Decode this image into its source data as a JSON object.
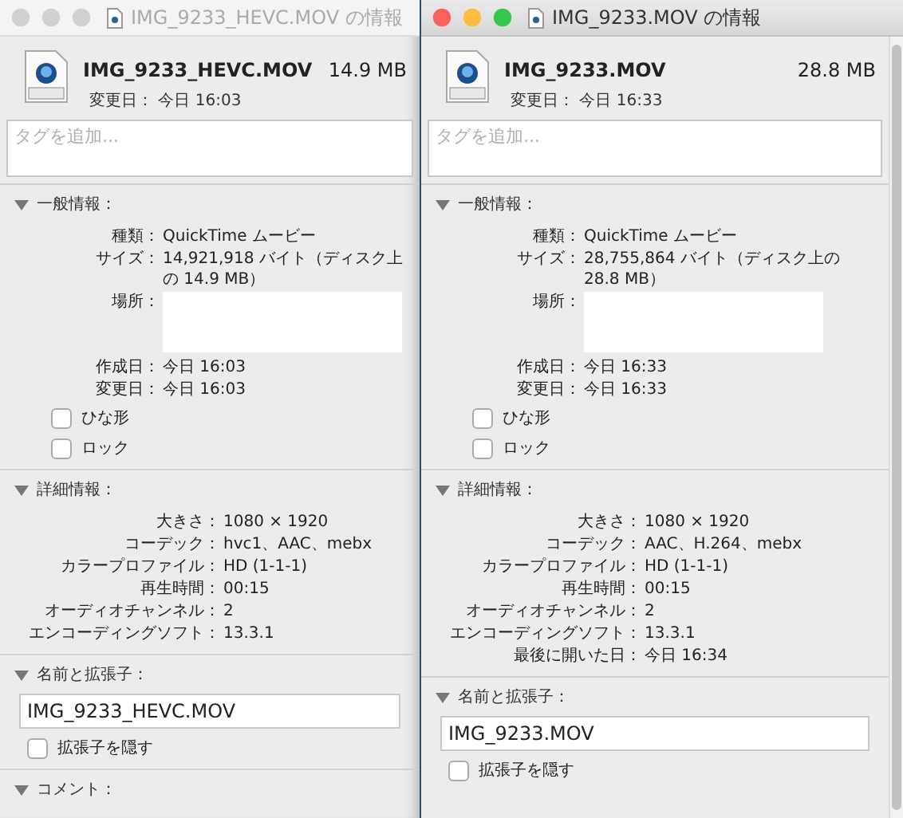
{
  "windows": [
    {
      "active": false,
      "title": "IMG_9233_HEVC.MOV の情報",
      "file_name": "IMG_9233_HEVC.MOV",
      "file_size": "14.9 MB",
      "modified": "変更日： 今日 16:03",
      "tags": {
        "placeholder": "タグを追加..."
      },
      "general": {
        "heading": "一般情報：",
        "expanded": true,
        "rows": [
          {
            "kind": "text",
            "label": "種類：",
            "value": "QuickTime ムービー"
          },
          {
            "kind": "text",
            "label": "サイズ：",
            "value": "14,921,918 バイト（ディスク上の 14.9 MB）"
          },
          {
            "kind": "redacted",
            "label": "場所："
          },
          {
            "kind": "text",
            "label": "作成日：",
            "value": "今日 16:03"
          },
          {
            "kind": "text",
            "label": "変更日：",
            "value": "今日 16:03"
          }
        ],
        "checkboxes": [
          {
            "label": "ひな形",
            "checked": false
          },
          {
            "label": "ロック",
            "checked": false
          }
        ]
      },
      "details": {
        "heading": "詳細情報：",
        "expanded": true,
        "rows": [
          {
            "label": "大きさ：",
            "value": "1080 × 1920"
          },
          {
            "label": "コーデック：",
            "value": "hvc1、AAC、mebx"
          },
          {
            "label": "カラープロファイル：",
            "value": "HD (1-1-1)"
          },
          {
            "label": "再生時間：",
            "value": "00:15"
          },
          {
            "label": "オーディオチャンネル：",
            "value": "2"
          },
          {
            "label": "エンコーディングソフト：",
            "value": "13.3.1"
          }
        ]
      },
      "name_section": {
        "heading": "名前と拡張子：",
        "expanded": true,
        "value": "IMG_9233_HEVC.MOV",
        "hide_extension": {
          "label": "拡張子を隠す",
          "checked": false
        }
      },
      "comment_section": {
        "heading": "コメント：",
        "expanded": true
      }
    },
    {
      "active": true,
      "title": "IMG_9233.MOV の情報",
      "file_name": "IMG_9233.MOV",
      "file_size": "28.8 MB",
      "modified": "変更日： 今日 16:33",
      "tags": {
        "placeholder": "タグを追加..."
      },
      "general": {
        "heading": "一般情報：",
        "expanded": true,
        "rows": [
          {
            "kind": "text",
            "label": "種類：",
            "value": "QuickTime ムービー"
          },
          {
            "kind": "text",
            "label": "サイズ：",
            "value": "28,755,864 バイト（ディスク上の 28.8 MB）"
          },
          {
            "kind": "redacted",
            "label": "場所："
          },
          {
            "kind": "text",
            "label": "作成日：",
            "value": "今日 16:33"
          },
          {
            "kind": "text",
            "label": "変更日：",
            "value": "今日 16:33"
          }
        ],
        "checkboxes": [
          {
            "label": "ひな形",
            "checked": false
          },
          {
            "label": "ロック",
            "checked": false
          }
        ]
      },
      "details": {
        "heading": "詳細情報：",
        "expanded": true,
        "rows": [
          {
            "label": "大きさ：",
            "value": "1080 × 1920"
          },
          {
            "label": "コーデック：",
            "value": "AAC、H.264、mebx"
          },
          {
            "label": "カラープロファイル：",
            "value": "HD (1-1-1)"
          },
          {
            "label": "再生時間：",
            "value": "00:15"
          },
          {
            "label": "オーディオチャンネル：",
            "value": "2"
          },
          {
            "label": "エンコーディングソフト：",
            "value": "13.3.1"
          },
          {
            "label": "最後に開いた日：",
            "value": "今日 16:34"
          }
        ]
      },
      "name_section": {
        "heading": "名前と拡張子：",
        "expanded": true,
        "value": "IMG_9233.MOV",
        "hide_extension": {
          "label": "拡張子を隠す",
          "checked": false
        }
      }
    }
  ]
}
